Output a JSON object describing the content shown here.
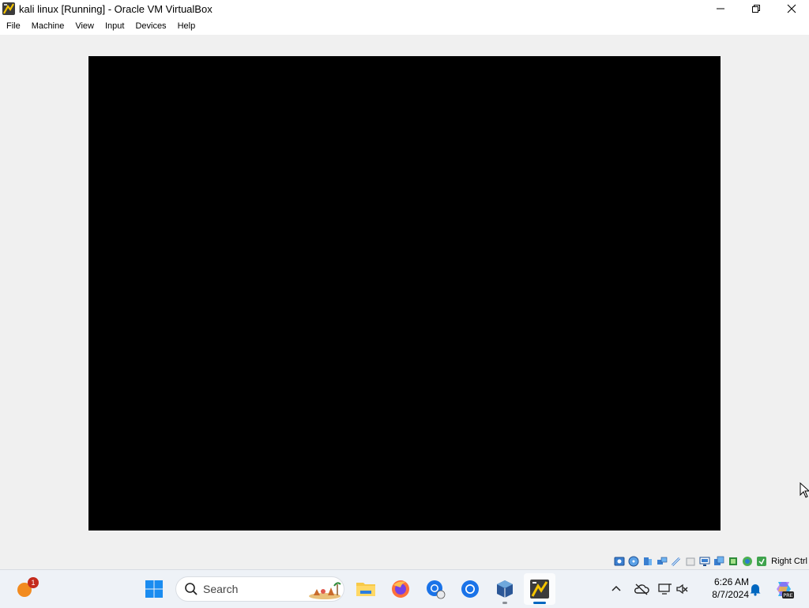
{
  "window": {
    "title": "kali linux [Running] - Oracle VM VirtualBox",
    "app_icon": "kali-icon",
    "controls": [
      "minimize-icon",
      "restore-icon",
      "close-icon"
    ]
  },
  "menu": {
    "items": [
      {
        "label": "File"
      },
      {
        "label": "Machine"
      },
      {
        "label": "View"
      },
      {
        "label": "Input"
      },
      {
        "label": "Devices"
      },
      {
        "label": "Help"
      }
    ]
  },
  "vm": {
    "screen_color": "#000000"
  },
  "statusbar": {
    "icons": [
      "hard-disk-icon",
      "optical-drive-icon",
      "audio-icon",
      "network-icon",
      "usb-icon",
      "shared-folders-icon",
      "display-icon",
      "recording-icon",
      "cpu-virtualization-icon",
      "guest-additions-icon",
      "mouse-integration-icon"
    ],
    "host_key_label": "Right Ctrl"
  },
  "taskbar": {
    "weather_badge": "1",
    "search_placeholder": "Search",
    "apps": [
      "start-icon",
      "file-explorer-icon",
      "firefox-icon",
      "chrome-canary-icon",
      "chrome-icon",
      "virtualbox-icon",
      "kali-vm-icon"
    ],
    "active_app": "kali-vm-icon",
    "tray_icons": [
      "chevron-up-icon",
      "onedrive-offline-icon",
      "display-network-icon",
      "volume-muted-icon"
    ],
    "time": "6:26 AM",
    "date": "8/7/2024",
    "notification_icon": "bell-icon",
    "copilot_label": "PRE",
    "accent_color": "#0067c0"
  }
}
